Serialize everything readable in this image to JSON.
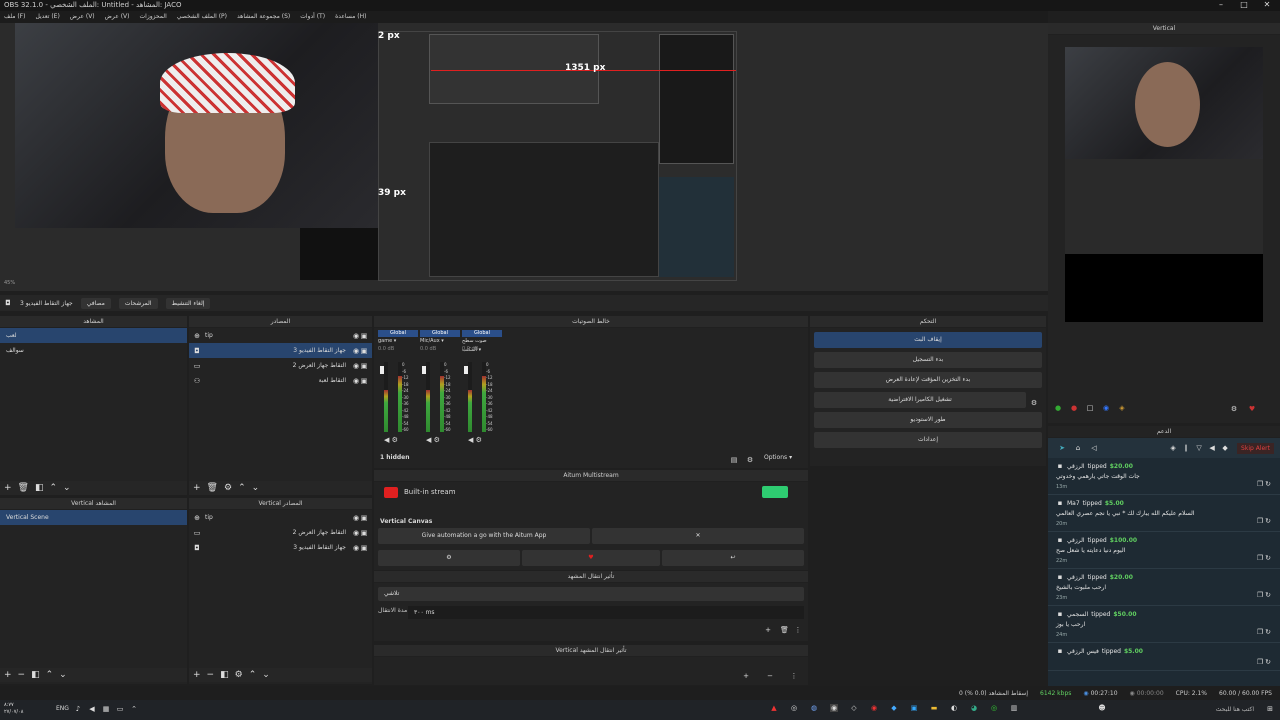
{
  "window": {
    "title": "OBS 32.1.0 - الملف الشخصي: Untitled - المشاهد: JACO"
  },
  "menu": [
    "ملف (F)",
    "تعديل (E)",
    "عرض (V)",
    "عرض (V)",
    "المحزوزات",
    "الملف الشخصي (P)",
    "مجموعة المشاهد (S)",
    "أدوات (T)",
    "مساعدة (H)"
  ],
  "preview": {
    "label_top": "2 px",
    "label_right": "1351 px",
    "label_bottom": "39 px",
    "zoom": "45%"
  },
  "vertical_panel": {
    "title": "Vertical"
  },
  "context_bar": {
    "source_name": "جهاز التقاط الفيديو 3",
    "properties": "مصافي",
    "filters": "المرشحات",
    "deactivate": "إلغاء التنشيط"
  },
  "scenes": {
    "title": "المشاهد",
    "items": [
      "لعب",
      "سوالف"
    ]
  },
  "sources": {
    "title": "المصادر",
    "items": [
      "tip",
      "جهاز التقاط الفيديو 3",
      "التقاط جهاز العرض 2",
      "التقاط لعبة"
    ]
  },
  "audio": {
    "title": "خالط الصوتيات",
    "channels": [
      {
        "tag": "Global",
        "name": "game",
        "db": "0.0 dB"
      },
      {
        "tag": "Global",
        "name": "Mic/Aux",
        "db": "0.0 dB"
      },
      {
        "tag": "Global",
        "name": "صوت سطح المكتب",
        "db": "0.0 dB"
      }
    ],
    "scale": [
      "0",
      "-6",
      "-12",
      "-18",
      "-24",
      "-30",
      "-36",
      "-42",
      "-48",
      "-54",
      "-60"
    ],
    "hidden": "1 hidden",
    "options": "Options"
  },
  "controls": {
    "title": "التحكم",
    "buttons": [
      "إيقاف البث",
      "بدء التسجيل",
      "بدء التخزين المؤقت لإعادة العرض",
      "تشغيل الكاميرا الافتراضية",
      "طور الاستوديو",
      "إعدادات"
    ]
  },
  "aitum": {
    "title": "Aitum Multistream",
    "stream": "Built-in stream",
    "vertical_canvas": "Vertical Canvas",
    "promo": "Give automation a go with the Aitum App"
  },
  "transition": {
    "title": "تأثير انتقال المشهد",
    "type": "تلاشي",
    "duration_label": "مدة الانتقال",
    "duration": "٣٠٠ ms",
    "vertical_title": "Vertical تأثير انتقال المشهد"
  },
  "vertical_scenes": {
    "title": "Vertical المشاهد",
    "items": [
      "Vertical Scene"
    ]
  },
  "vertical_sources": {
    "title": "Vertical المصادر",
    "items": [
      "tip",
      "التقاط جهاز العرض 2",
      "جهاز التقاط الفيديو 3"
    ]
  },
  "chat": {
    "title": "الدعم",
    "skip": "Skip Alert",
    "messages": [
      {
        "user": "الرزقي",
        "action": "tipped",
        "amount": "$20.00",
        "text": "جات الوقت جاتي يارهمي وخدوتي",
        "time": "13m"
      },
      {
        "user": "Ma7",
        "action": "tipped",
        "amount": "$5.00",
        "text": "السلام عليكم الله يبارك لك * نبي يا نجم عصري العالمي",
        "time": "20m"
      },
      {
        "user": "الرزقي",
        "action": "tipped",
        "amount": "$100.00",
        "text": "اليوم دنيا دعايته يا شعل صح",
        "time": "22m"
      },
      {
        "user": "الرزقي",
        "action": "tipped",
        "amount": "$20.00",
        "text": "ارحب ملبوت بالشيخ",
        "time": "23m"
      },
      {
        "user": "السجمي",
        "action": "tipped",
        "amount": "$50.00",
        "text": "ارحب يا بوز",
        "time": "24m"
      },
      {
        "user": "فيس الرزقي",
        "action": "tipped",
        "amount": "$5.00",
        "text": "",
        "time": ""
      }
    ]
  },
  "status": {
    "dropped": "إسقاط المشاهد (0.0 %) 0",
    "bitrate": "6142 kbps",
    "live_time": "00:27:10",
    "rec_time": "00:00:00",
    "cpu": "CPU: 2.1%",
    "fps": "60.00 / 60.00 FPS"
  },
  "taskbar": {
    "time": "٨:٧٧",
    "date": "٢٧/٠٧/٠٨",
    "lang": "ENG",
    "search": "اكتب هنا للبحث"
  },
  "colors": {
    "accent": "#28456e",
    "green": "#61d061",
    "red": "#d32f2f",
    "chat_bg": "#1e2a33"
  }
}
